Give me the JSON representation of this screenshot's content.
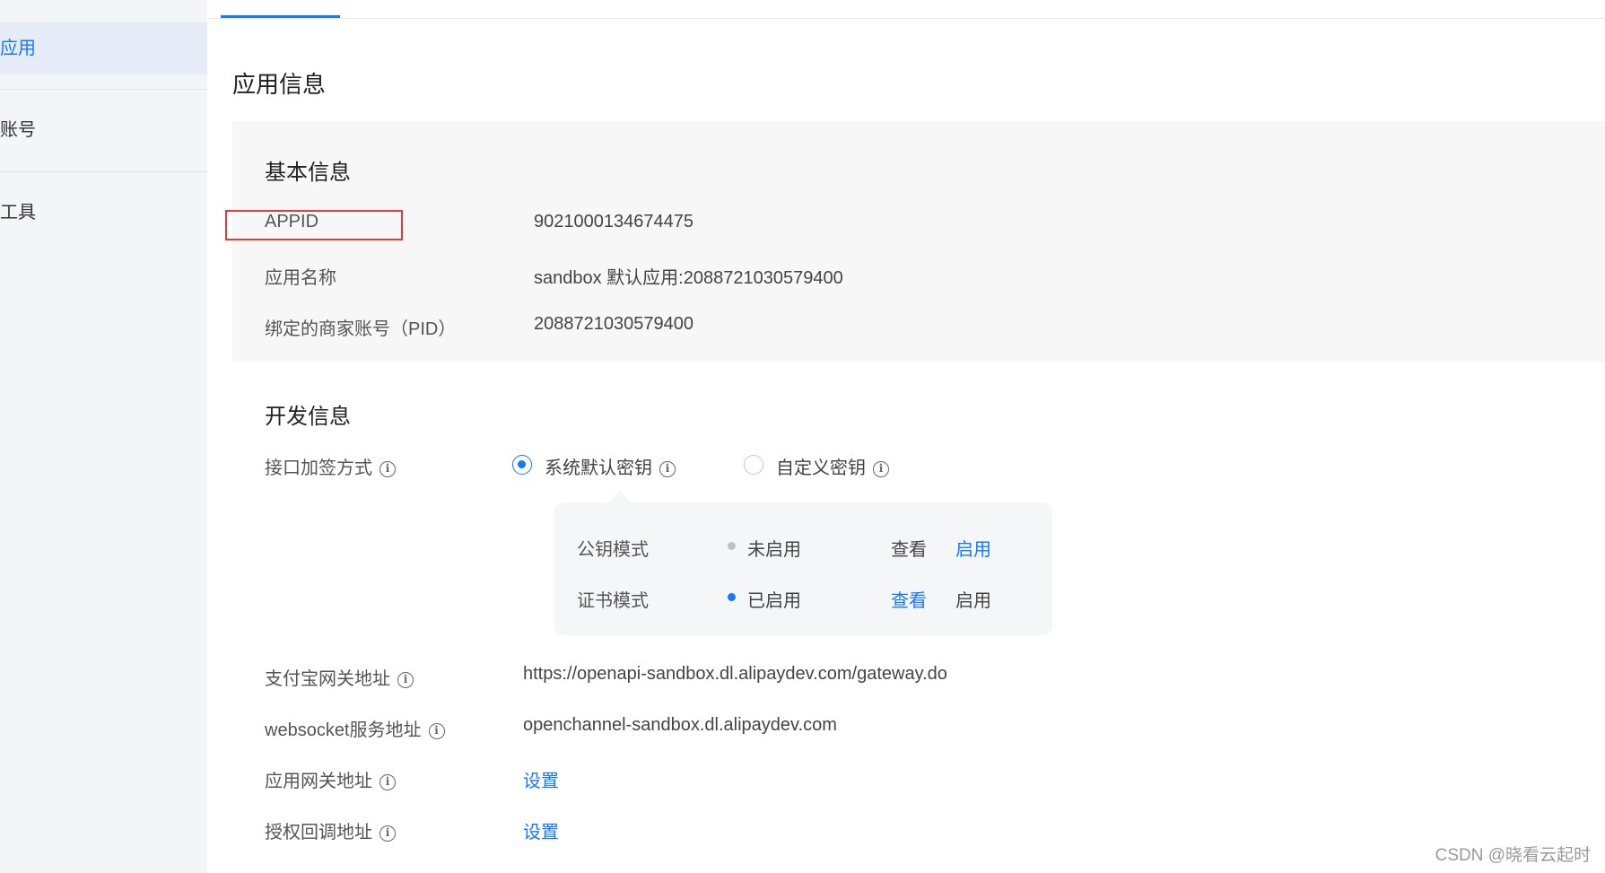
{
  "sidebar": {
    "items": [
      {
        "label": "应用",
        "active": true
      },
      {
        "label": "账号",
        "active": false
      },
      {
        "label": "工具",
        "active": false
      }
    ]
  },
  "page": {
    "title": "应用信息"
  },
  "basic_info": {
    "title": "基本信息",
    "rows": [
      {
        "label": "APPID",
        "value": "9021000134674475"
      },
      {
        "label": "应用名称",
        "value": "sandbox 默认应用:2088721030579400"
      },
      {
        "label": "绑定的商家账号（PID）",
        "value": "2088721030579400"
      }
    ]
  },
  "dev_info": {
    "title": "开发信息",
    "sign_method": {
      "label": "接口加签方式",
      "options": [
        {
          "label": "系统默认密钥",
          "checked": true
        },
        {
          "label": "自定义密钥",
          "checked": false
        }
      ]
    },
    "key_modes": [
      {
        "name": "公钥模式",
        "status": "未启用",
        "status_color": "#c0c0c0",
        "view": "查看",
        "enable": "启用"
      },
      {
        "name": "证书模式",
        "status": "已启用",
        "status_color": "#1677ff",
        "view": "查看",
        "enable": "启用"
      }
    ],
    "rows": [
      {
        "label": "支付宝网关地址",
        "value": "https://openapi-sandbox.dl.alipaydev.com/gateway.do"
      },
      {
        "label": "websocket服务地址",
        "value": "openchannel-sandbox.dl.alipaydev.com"
      },
      {
        "label": "应用网关地址",
        "value": "设置"
      },
      {
        "label": "授权回调地址",
        "value": "设置"
      }
    ]
  },
  "icons": {
    "info": "i"
  },
  "colors": {
    "accent": "#1677ff",
    "highlight": "#e03a3a"
  },
  "watermark": "CSDN @晓看云起时"
}
